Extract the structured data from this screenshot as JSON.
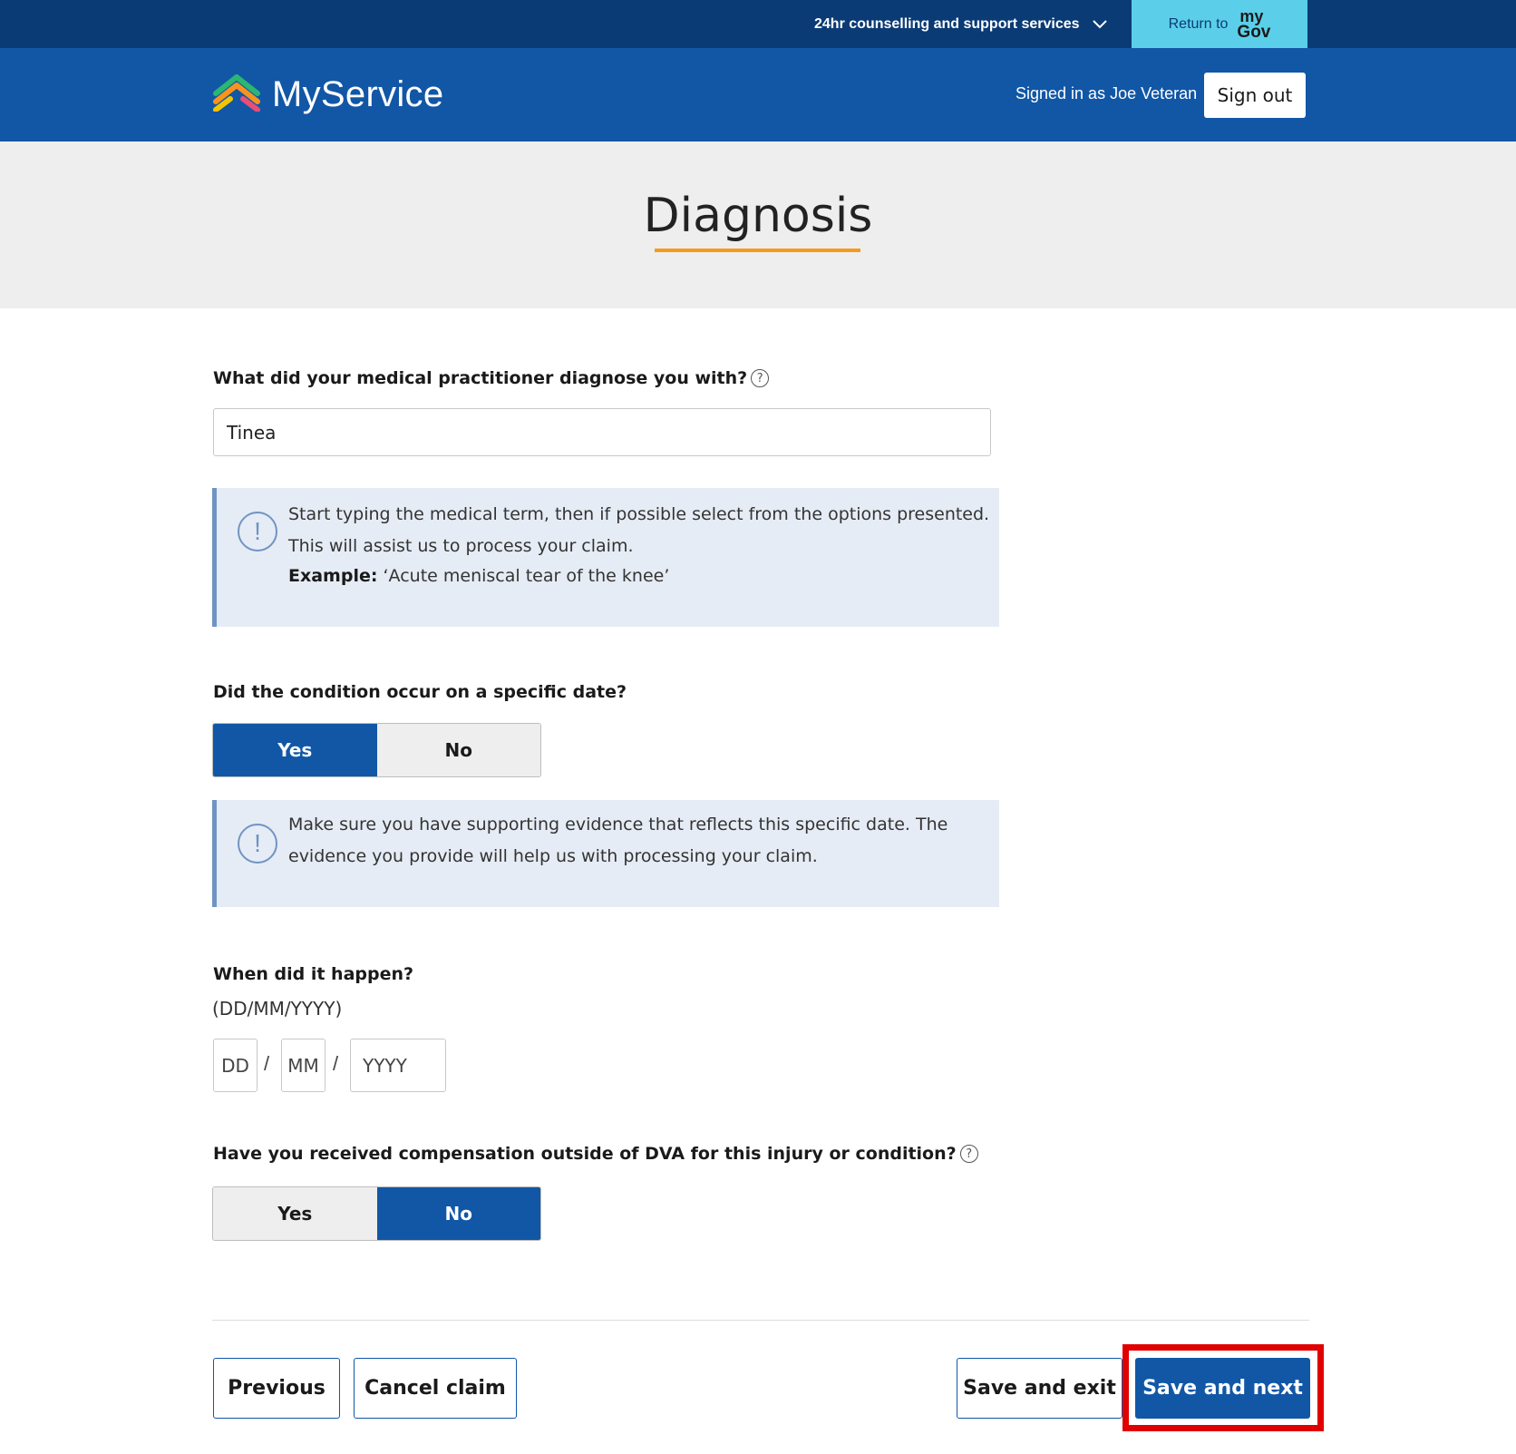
{
  "topbar": {
    "support_label": "24hr counselling and support services",
    "support_icon": "chevron-down-icon",
    "return_label": "Return to",
    "mygov_my": "my",
    "mygov_gov": "Gov"
  },
  "header": {
    "brand_name": "MyService",
    "signed_in_text": "Signed in as Joe Veteran",
    "sign_out_label": "Sign out"
  },
  "page": {
    "title": "Diagnosis"
  },
  "form": {
    "diagnosis_question": "What did your medical practitioner diagnose you with?",
    "diagnosis_value": "Tinea",
    "info1": {
      "line1": "Start typing the medical term, then if possible select from the options presented.",
      "line2": "This will assist us to process your claim.",
      "example_label": "Example:",
      "example_text": "‘Acute meniscal tear of the knee’"
    },
    "specific_date_question": "Did the condition occur on a specific date?",
    "specific_date_options": {
      "yes": "Yes",
      "no": "No",
      "selected": "Yes"
    },
    "info2": {
      "line1": "Make sure you have supporting evidence that reflects this specific date. The",
      "line2": "evidence you provide will help us with processing your claim."
    },
    "when_question": "When did it happen?",
    "date_format_hint": "(DD/MM/YYYY)",
    "date_placeholders": {
      "day": "DD",
      "month": "MM",
      "year": "YYYY"
    },
    "date_separator": "/",
    "compensation_question": "Have you received compensation outside of DVA for this injury or condition?",
    "compensation_options": {
      "yes": "Yes",
      "no": "No",
      "selected": "No"
    }
  },
  "footer_buttons": {
    "previous": "Previous",
    "cancel": "Cancel claim",
    "save_exit": "Save and exit",
    "save_next": "Save and next"
  },
  "colors": {
    "topbar_bg": "#0b3b75",
    "header_bg": "#1157a6",
    "return_bg": "#5bcfe9",
    "title_underline": "#f59a1b",
    "info_bg": "#e6ecf5",
    "highlight": "#e00000"
  },
  "icons": [
    "chevron-down-icon",
    "myservice-logo-icon",
    "help-icon",
    "info-icon"
  ]
}
